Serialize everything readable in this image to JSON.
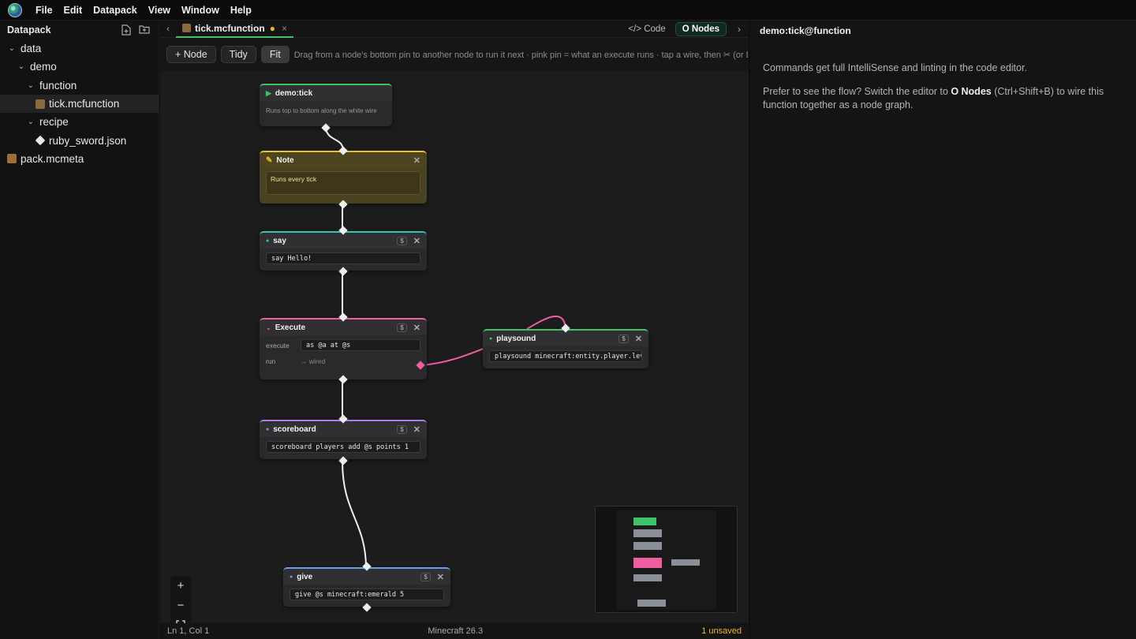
{
  "menu": [
    "File",
    "Edit",
    "Datapack",
    "View",
    "Window",
    "Help"
  ],
  "sidebar": {
    "title": "Datapack",
    "tree": [
      {
        "label": "data",
        "depth": 0,
        "expanded": true
      },
      {
        "label": "demo",
        "depth": 1,
        "expanded": true
      },
      {
        "label": "function",
        "depth": 2,
        "expanded": true
      },
      {
        "label": "tick.mcfunction",
        "depth": 3,
        "active": true
      },
      {
        "label": "recipe",
        "depth": 2,
        "expanded": true
      },
      {
        "label": "ruby_sword.json",
        "depth": 3
      },
      {
        "label": "pack.mcmeta",
        "depth": 0
      }
    ]
  },
  "tab": {
    "name": "tick.mcfunction",
    "dot": "●",
    "close": "×"
  },
  "modes": {
    "code": "</> Code",
    "nodes": "O Nodes"
  },
  "toolbar": {
    "add": "+ Node",
    "tidy": "Tidy",
    "fit": "Fit",
    "hint": "Drag from a node's bottom pin to another node to run it next · pink pin = what an execute runs · tap a wire, then ✂ (or Del..."
  },
  "nodes": {
    "entry": {
      "title": "demo:tick",
      "desc": "Runs top to bottom along the white wire"
    },
    "note": {
      "title": "Note",
      "text": "Runs every tick"
    },
    "say": {
      "title": "say",
      "cmd": "say Hello!"
    },
    "execute": {
      "title": "Execute",
      "execute_label": "execute",
      "execute_val": "as @a at @s",
      "run_label": "run",
      "run_val": "→ wired"
    },
    "playsound": {
      "title": "playsound",
      "cmd": "playsound minecraft:entity.player.levelup"
    },
    "scoreboard": {
      "title": "scoreboard",
      "cmd": "scoreboard players add @s points 1"
    },
    "give": {
      "title": "give",
      "cmd": "give @s minecraft:emerald 5"
    }
  },
  "badge": "$",
  "close": "✕",
  "status": {
    "pos": "Ln 1, Col 1",
    "version": "Minecraft 26.3",
    "unsaved": "1 unsaved"
  },
  "inspector": {
    "title": "demo:tick@function",
    "p1": "Commands get full IntelliSense and linting in the code editor.",
    "p2_a": "Prefer to see the flow? Switch the editor to ",
    "p2_b": "O Nodes",
    "p2_c": " (Ctrl+Shift+B) to wire this function together as a node graph."
  },
  "colors": {
    "green": "#3ec36a",
    "yellow": "#e6c229",
    "teal": "#35c6b8",
    "pink": "#ef5ea1",
    "violet": "#b07ce8",
    "blue": "#6a9be8"
  }
}
